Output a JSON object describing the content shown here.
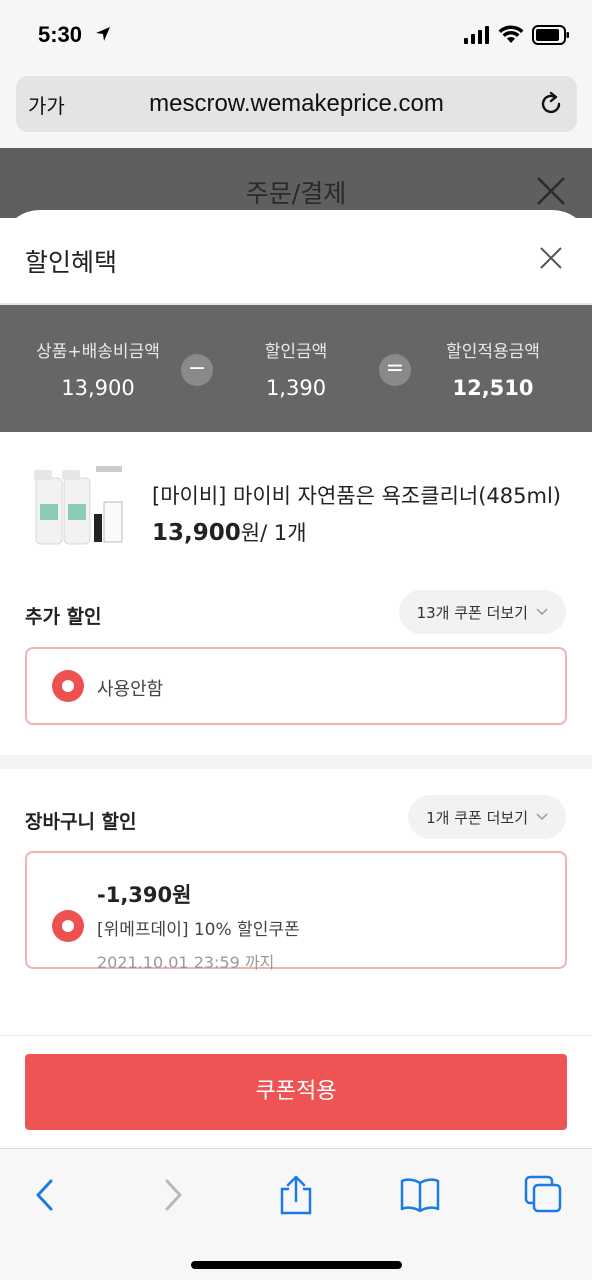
{
  "status_bar": {
    "time": "5:30"
  },
  "browser": {
    "aa_label": "가가",
    "url": "mescrow.wemakeprice.com"
  },
  "page_behind": {
    "title": "주문/결제"
  },
  "sheet": {
    "title": "할인혜택",
    "summary": {
      "product_ship_label": "상품+배송비금액",
      "product_ship_value": "13,900",
      "minus_symbol": "−",
      "discount_label": "할인금액",
      "discount_value": "1,390",
      "equals_symbol": "=",
      "final_label": "할인적용금액",
      "final_value": "12,510"
    },
    "product": {
      "name": "[마이비] 마이비 자연품은 욕조클리너(485ml)",
      "price": "13,900",
      "price_suffix": "원/ 1개"
    },
    "additional_discount": {
      "label": "추가 할인",
      "more_button": "13개 쿠폰 더보기",
      "selected_option": "사용안함"
    },
    "cart_discount": {
      "label": "장바구니 할인",
      "more_button": "1개 쿠폰 더보기",
      "coupon_amount": "-1,390원",
      "coupon_name": "[위메프데이] 10% 할인쿠폰",
      "coupon_expiry": "2021.10.01 23:59 까지"
    },
    "apply_button": "쿠폰적용"
  },
  "colors": {
    "accent": "#ef5454",
    "radio": "#ef5151",
    "summary_bg": "#666666",
    "ios_blue": "#1a7be6"
  },
  "toolbar": {
    "icons": [
      "back-icon",
      "forward-icon",
      "share-icon",
      "bookmarks-icon",
      "tabs-icon"
    ]
  }
}
